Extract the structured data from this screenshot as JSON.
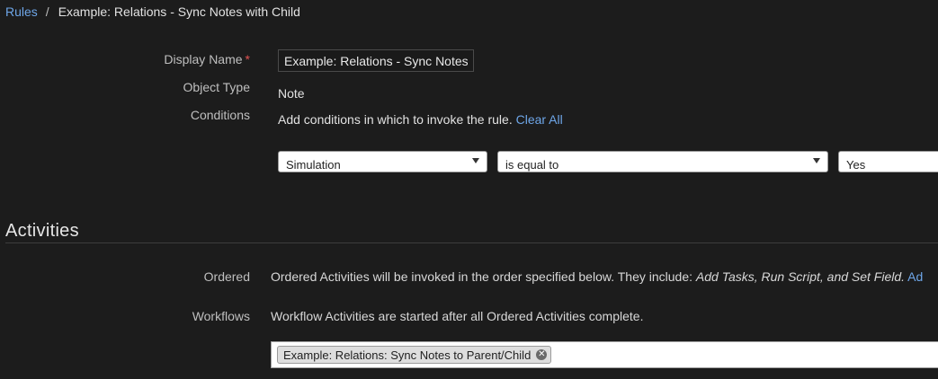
{
  "breadcrumb": {
    "root": "Rules",
    "separator": "/",
    "current": "Example: Relations - Sync Notes with Child"
  },
  "form": {
    "display_name_label": "Display Name",
    "required_mark": "*",
    "display_name_value": "Example: Relations - Sync Notes",
    "object_type_label": "Object Type",
    "object_type_value": "Note",
    "conditions_label": "Conditions",
    "conditions_text": "Add conditions in which to invoke the rule.",
    "clear_all": "Clear All",
    "condition": {
      "field": "Simulation",
      "operator": "is equal to",
      "value": "Yes"
    }
  },
  "activities": {
    "title": "Activities",
    "ordered_label": "Ordered",
    "ordered_text": "Ordered Activities will be invoked in the order specified below. They include:",
    "ordered_examples": "Add Tasks, Run Script, and Set Field.",
    "ordered_link": "Ad",
    "workflows_label": "Workflows",
    "workflows_text": "Workflow Activities are started after all Ordered Activities complete.",
    "workflow_tags": [
      "Example: Relations: Sync Notes to Parent/Child"
    ],
    "remove_glyph": "✕"
  },
  "colors": {
    "background": "#1c1c1c",
    "link": "#6ea6e8",
    "required": "#e05252"
  }
}
